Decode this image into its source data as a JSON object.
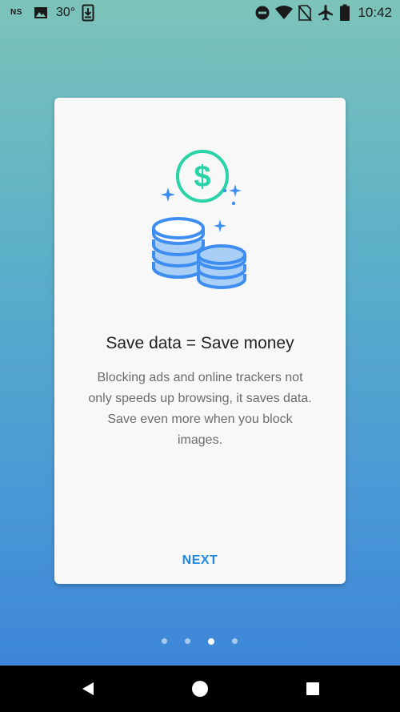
{
  "status_bar": {
    "carrier_label": "NS",
    "temperature": "30°",
    "time": "10:42",
    "icons": [
      "image-icon",
      "download-icon",
      "do-not-disturb-icon",
      "wifi-icon",
      "no-sim-icon",
      "airplane-mode-icon",
      "battery-icon"
    ]
  },
  "card": {
    "illustration": "coins-savings-illustration",
    "title": "Save data = Save money",
    "body": "Blocking ads and online trackers not only speeds up browsing, it saves data. Save even more when you block images.",
    "next_label": "NEXT"
  },
  "pager": {
    "count": 4,
    "active_index": 2
  },
  "navigation": {
    "buttons": [
      "back-icon",
      "home-icon",
      "recents-icon"
    ]
  },
  "colors": {
    "accent": "#1e88e5",
    "teal_accent": "#29d3a8",
    "coin_blue": "#3d8ef0",
    "coin_light_blue": "#a9cff7"
  }
}
